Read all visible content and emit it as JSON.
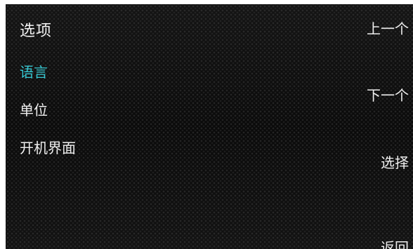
{
  "screen": {
    "title": "选项",
    "menu_items": [
      {
        "label": "语言",
        "selected": true
      },
      {
        "label": "单位",
        "selected": false
      },
      {
        "label": "开机界面",
        "selected": false
      }
    ],
    "softkeys": {
      "prev": "上一个",
      "next": "下一个",
      "select": "选择",
      "back": "返回"
    }
  },
  "colors": {
    "selected": "#37c8d2",
    "text": "#f0f0f0",
    "background": "#0c0c0c"
  }
}
